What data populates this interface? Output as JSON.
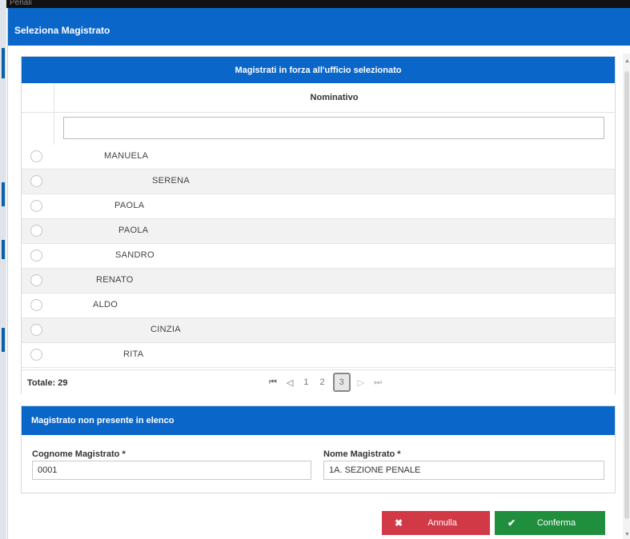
{
  "background": {
    "top_text": "Penali"
  },
  "dialog": {
    "title": "Seleziona Magistrato"
  },
  "table": {
    "heading": "Magistrati in forza all'ufficio selezionato",
    "column_header": "Nominativo",
    "filter_value": "",
    "rows": [
      {
        "name": "MANUELA"
      },
      {
        "name": "SERENA"
      },
      {
        "name": "PAOLA"
      },
      {
        "name": "PAOLA"
      },
      {
        "name": "SANDRO"
      },
      {
        "name": "RENATO"
      },
      {
        "name": "ALDO"
      },
      {
        "name": "CINZIA"
      },
      {
        "name": "RITA"
      }
    ],
    "total_label": "Totale: 29",
    "pager": {
      "first_icon": "first-page-icon",
      "prev_icon": "prev-page-icon",
      "pages": [
        "1",
        "2",
        "3"
      ],
      "current_page": "3",
      "next_icon": "next-page-icon",
      "last_icon": "last-page-icon"
    }
  },
  "manual": {
    "heading": "Magistrato non presente in elenco",
    "surname_label": "Cognome Magistrato *",
    "surname_value": "0001",
    "name_label": "Nome Magistrato *",
    "name_value": "1A. SEZIONE PENALE"
  },
  "buttons": {
    "cancel_label": "Annulla",
    "cancel_icon": "close-icon",
    "confirm_label": "Conferma",
    "confirm_icon": "check-icon"
  },
  "colors": {
    "header_blue": "#0a66c8",
    "cancel_red": "#d23946",
    "confirm_green": "#1f8e3d"
  }
}
